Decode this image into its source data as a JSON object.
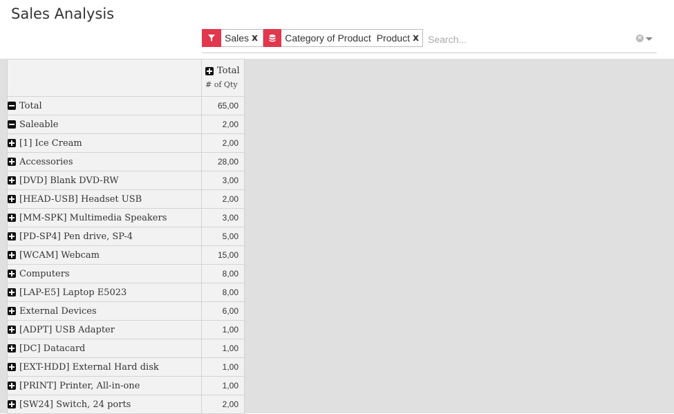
{
  "page": {
    "title": "Sales Analysis"
  },
  "search": {
    "placeholder": "Search...",
    "facets": [
      {
        "icon": "filter-icon",
        "values": [
          "Sales"
        ]
      },
      {
        "icon": "group-by-icon",
        "values": [
          "Category of Product",
          "Product"
        ]
      }
    ],
    "remove_label": "x"
  },
  "pivot": {
    "column_header": "Total",
    "measure": "# of Qty",
    "rows": [
      {
        "label": "Total",
        "value": "65,00",
        "level": 0,
        "expanded": true
      },
      {
        "label": "Saleable",
        "value": "2,00",
        "level": 1,
        "expanded": true
      },
      {
        "label": "[1] Ice Cream",
        "value": "2,00",
        "level": 2,
        "expanded": false
      },
      {
        "label": "Accessories",
        "value": "28,00",
        "level": 1,
        "expanded": false
      },
      {
        "label": "[DVD] Blank DVD-RW",
        "value": "3,00",
        "level": 2,
        "expanded": false
      },
      {
        "label": "[HEAD-USB] Headset USB",
        "value": "2,00",
        "level": 2,
        "expanded": false
      },
      {
        "label": "[MM-SPK] Multimedia Speakers",
        "value": "3,00",
        "level": 2,
        "expanded": false
      },
      {
        "label": "[PD-SP4] Pen drive, SP-4",
        "value": "5,00",
        "level": 2,
        "expanded": false
      },
      {
        "label": "[WCAM] Webcam",
        "value": "15,00",
        "level": 2,
        "expanded": false
      },
      {
        "label": "Computers",
        "value": "8,00",
        "level": 1,
        "expanded": false
      },
      {
        "label": "[LAP-E5] Laptop E5023",
        "value": "8,00",
        "level": 2,
        "expanded": false
      },
      {
        "label": "External Devices",
        "value": "6,00",
        "level": 1,
        "expanded": false
      },
      {
        "label": "[ADPT] USB Adapter",
        "value": "1,00",
        "level": 2,
        "expanded": false
      },
      {
        "label": "[DC] Datacard",
        "value": "1,00",
        "level": 2,
        "expanded": false
      },
      {
        "label": "[EXT-HDD] External Hard disk",
        "value": "1,00",
        "level": 2,
        "expanded": false
      },
      {
        "label": "[PRINT] Printer, All-in-one",
        "value": "1,00",
        "level": 2,
        "expanded": false
      },
      {
        "label": "[SW24] Switch, 24 ports",
        "value": "2,00",
        "level": 2,
        "expanded": false
      }
    ]
  },
  "colors": {
    "facet_accent": "#e2374c",
    "cell_bg": "#f2f2f2",
    "canvas_bg": "#e0e0e0"
  }
}
